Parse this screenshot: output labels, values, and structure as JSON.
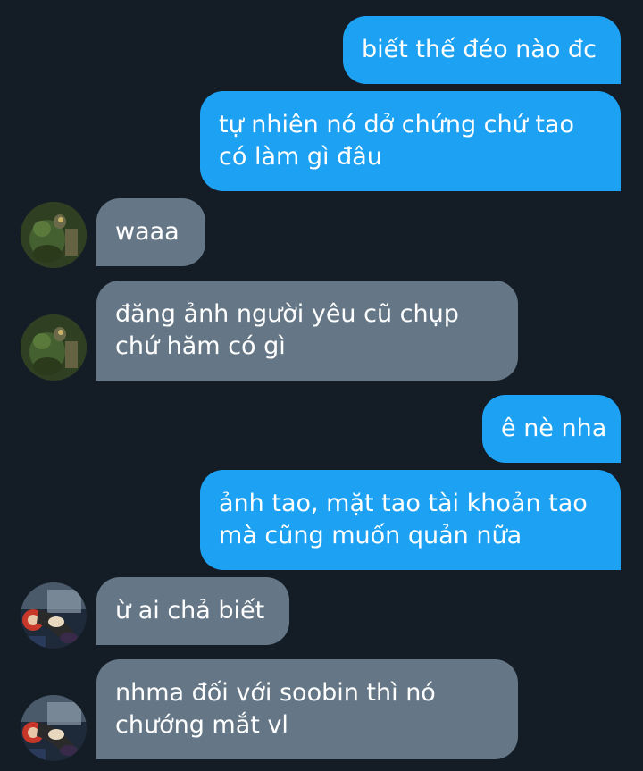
{
  "colors": {
    "background": "#141d26",
    "sent_bubble": "#1da1f2",
    "received_bubble": "#657786",
    "text": "#ffffff"
  },
  "messages": [
    {
      "from": "me",
      "lines": [
        "biết thế đéo nào đc"
      ]
    },
    {
      "from": "me",
      "lines": [
        "tự nhiên nó dở chứng chứ tao",
        "có làm gì đâu"
      ]
    },
    {
      "from": "other",
      "avatar": "green-figure-avatar",
      "lines": [
        "waaa"
      ]
    },
    {
      "from": "other",
      "avatar": "green-figure-avatar",
      "lines": [
        "đăng ảnh người yêu cũ chụp",
        "chứ hăm có gì"
      ]
    },
    {
      "from": "me",
      "lines": [
        "ê nè nha"
      ]
    },
    {
      "from": "me",
      "lines": [
        "ảnh tao, mặt tao tài khoản tao",
        "mà cũng muốn quản nữa"
      ]
    },
    {
      "from": "other",
      "avatar": "cartoon-witch-avatar",
      "lines": [
        "ừ ai chả biết"
      ]
    },
    {
      "from": "other",
      "avatar": "cartoon-witch-avatar",
      "lines": [
        "nhma đối với soobin thì nó",
        "chướng mắt vl"
      ]
    }
  ]
}
